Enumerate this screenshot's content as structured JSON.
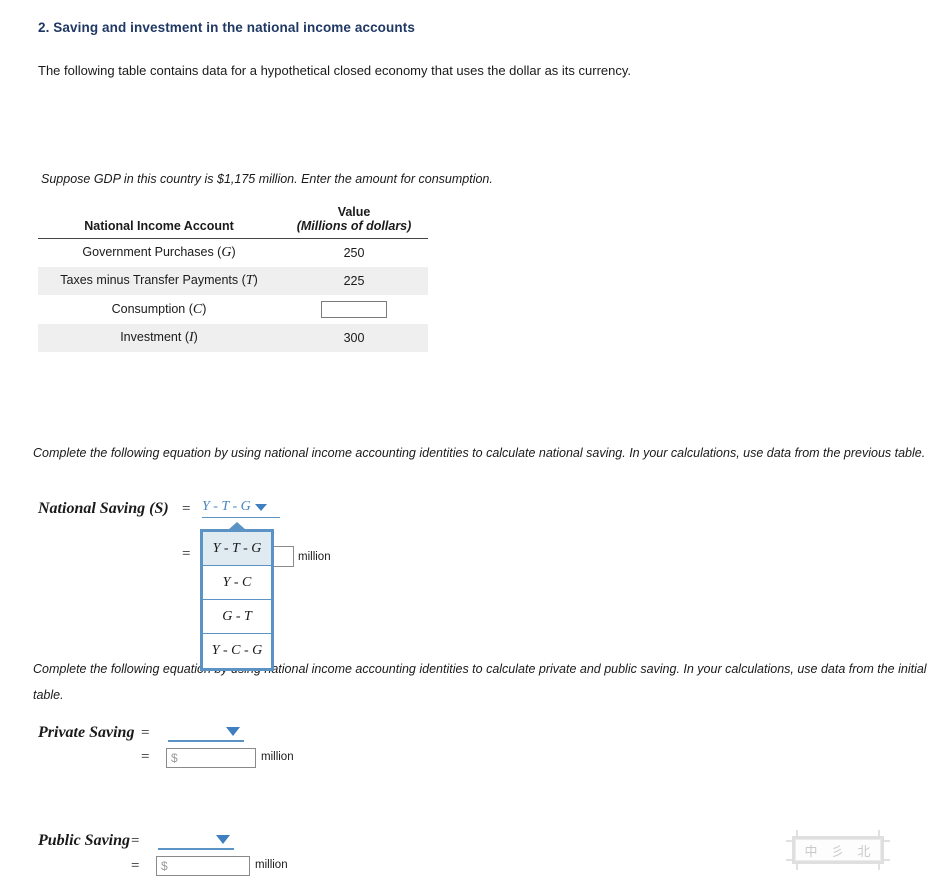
{
  "question": {
    "title": "2. Saving and investment in the national income accounts",
    "intro": "The following table contains data for a hypothetical closed economy that uses the dollar as its currency.",
    "suppose": "Suppose GDP in this country is $1,175 million. Enter the amount for consumption."
  },
  "table": {
    "headers": {
      "account": "National Income Account",
      "value_line1": "Value",
      "value_line2": "(Millions of dollars)"
    },
    "rows": [
      {
        "label": "Government Purchases",
        "symbol": "G",
        "value": "250",
        "input": false,
        "shaded": false
      },
      {
        "label": "Taxes minus Transfer Payments",
        "symbol": "T",
        "value": "225",
        "input": false,
        "shaded": true
      },
      {
        "label": "Consumption",
        "symbol": "C",
        "value": "",
        "input": true,
        "shaded": false
      },
      {
        "label": "Investment",
        "symbol": "I",
        "value": "300",
        "input": false,
        "shaded": true
      }
    ]
  },
  "national_saving": {
    "instruction": "Complete the following equation by using national income accounting identities to calculate national saving. In your calculations, use data from the previous table.",
    "label": "National Saving (S)",
    "equals1": "=",
    "equals2": "=",
    "selected_option": "Y - T - G",
    "amount_value": "",
    "unit": "million",
    "dropdown_options": [
      "Y - T - G",
      "Y - C",
      "G - T",
      "Y - C - G"
    ]
  },
  "private_public": {
    "instruction": "Complete the following equation by using national income accounting identities to calculate private and public saving. In your calculations, use data from the initial table.",
    "private": {
      "label": "Private Saving",
      "equals1": "=",
      "equals2": "=",
      "selected_option": "",
      "amount_placeholder": "$",
      "amount_value": "",
      "unit": "million"
    },
    "public": {
      "label": "Public Saving",
      "equals1": "=",
      "equals2": "=",
      "selected_option": "",
      "amount_placeholder": "$",
      "amount_value": "",
      "unit": "million"
    }
  },
  "watermark": {
    "chars": [
      "中",
      "彡",
      "北"
    ]
  },
  "colors": {
    "title_navy": "#1f3864",
    "accent_blue": "#5b93c4",
    "select_blue": "#4a86c0",
    "row_shade": "#efefef",
    "highlight": "#dfeaf1"
  }
}
